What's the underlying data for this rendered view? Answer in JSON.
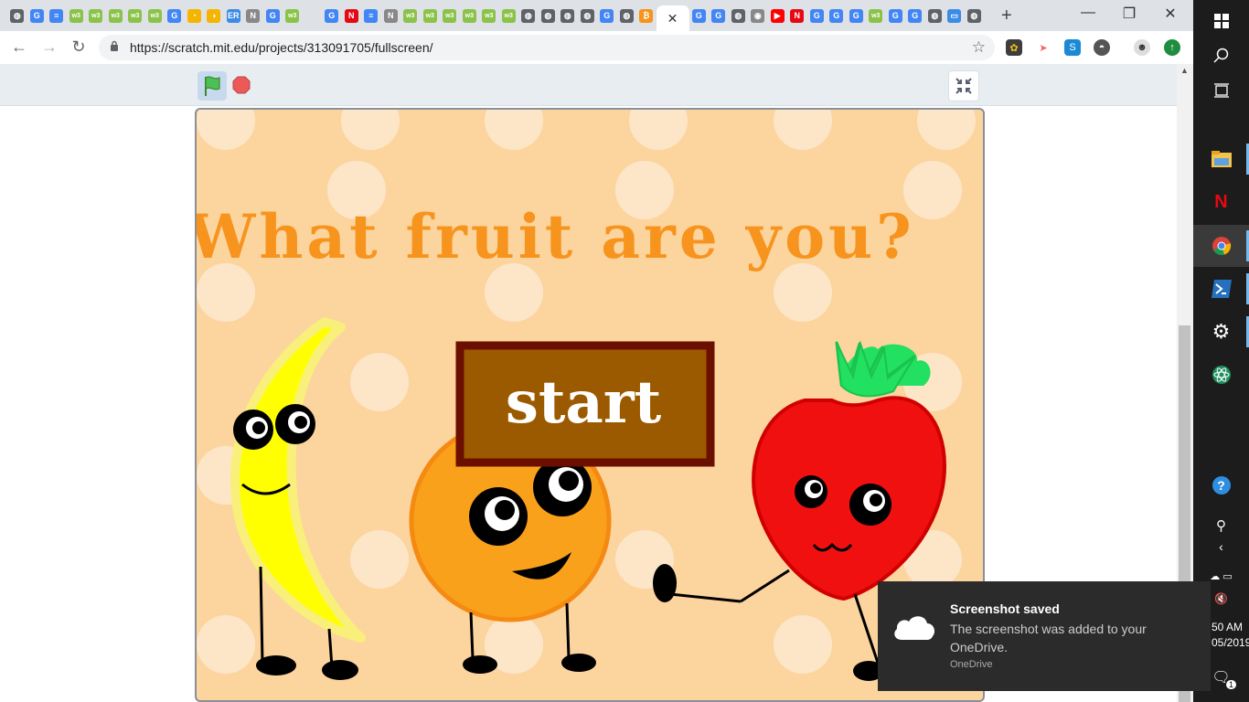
{
  "browser": {
    "tabs": [
      {
        "icon": "globe",
        "color": "#5f6368",
        "glyph": "◍"
      },
      {
        "icon": "google",
        "color": "#4285f4",
        "glyph": "G"
      },
      {
        "icon": "docs",
        "color": "#4285f4",
        "glyph": "≡"
      },
      {
        "icon": "w3",
        "color": "#8bc34a",
        "glyph": "w3"
      },
      {
        "icon": "w3",
        "color": "#8bc34a",
        "glyph": "w3"
      },
      {
        "icon": "w3",
        "color": "#8bc34a",
        "glyph": "w3"
      },
      {
        "icon": "w3",
        "color": "#8bc34a",
        "glyph": "w3"
      },
      {
        "icon": "w3",
        "color": "#8bc34a",
        "glyph": "w3"
      },
      {
        "icon": "google",
        "color": "#4285f4",
        "glyph": "G"
      },
      {
        "icon": "rainbow",
        "color": "#f4b400",
        "glyph": "◔"
      },
      {
        "icon": "khan",
        "color": "#f4b400",
        "glyph": "◑"
      },
      {
        "icon": "reader",
        "color": "#3c8be6",
        "glyph": "ER"
      },
      {
        "icon": "notion",
        "color": "#888",
        "glyph": "N"
      },
      {
        "icon": "google",
        "color": "#4285f4",
        "glyph": "G"
      },
      {
        "icon": "w3",
        "color": "#8bc34a",
        "glyph": "w3"
      },
      {
        "icon": "blank",
        "color": "#dee1e6",
        "glyph": ""
      },
      {
        "icon": "google",
        "color": "#4285f4",
        "glyph": "G"
      },
      {
        "icon": "netflix",
        "color": "#e50914",
        "glyph": "N"
      },
      {
        "icon": "docs",
        "color": "#4285f4",
        "glyph": "≡"
      },
      {
        "icon": "notion",
        "color": "#888",
        "glyph": "N"
      },
      {
        "icon": "w3",
        "color": "#8bc34a",
        "glyph": "w3"
      },
      {
        "icon": "w3",
        "color": "#8bc34a",
        "glyph": "w3"
      },
      {
        "icon": "w3",
        "color": "#8bc34a",
        "glyph": "w3"
      },
      {
        "icon": "w3",
        "color": "#8bc34a",
        "glyph": "w3"
      },
      {
        "icon": "w3",
        "color": "#8bc34a",
        "glyph": "w3"
      },
      {
        "icon": "w3",
        "color": "#8bc34a",
        "glyph": "w3"
      },
      {
        "icon": "globe",
        "color": "#5f6368",
        "glyph": "◍"
      },
      {
        "icon": "globe",
        "color": "#5f6368",
        "glyph": "◍"
      },
      {
        "icon": "globe",
        "color": "#5f6368",
        "glyph": "◍"
      },
      {
        "icon": "globe",
        "color": "#5f6368",
        "glyph": "◍"
      },
      {
        "icon": "google",
        "color": "#4285f4",
        "glyph": "G"
      },
      {
        "icon": "globe",
        "color": "#5f6368",
        "glyph": "◍"
      },
      {
        "icon": "bitcoin",
        "color": "#f7931a",
        "glyph": "₿"
      },
      {
        "icon": "close",
        "color": "#fff",
        "glyph": "✕",
        "active": true
      },
      {
        "icon": "google",
        "color": "#4285f4",
        "glyph": "G"
      },
      {
        "icon": "google",
        "color": "#4285f4",
        "glyph": "G"
      },
      {
        "icon": "globe",
        "color": "#5f6368",
        "glyph": "◍"
      },
      {
        "icon": "owl",
        "color": "#888",
        "glyph": "◉"
      },
      {
        "icon": "youtube",
        "color": "#ff0000",
        "glyph": "▶"
      },
      {
        "icon": "netflix",
        "color": "#e50914",
        "glyph": "N"
      },
      {
        "icon": "google",
        "color": "#4285f4",
        "glyph": "G"
      },
      {
        "icon": "google",
        "color": "#4285f4",
        "glyph": "G"
      },
      {
        "icon": "google",
        "color": "#4285f4",
        "glyph": "G"
      },
      {
        "icon": "w3",
        "color": "#8bc34a",
        "glyph": "w3"
      },
      {
        "icon": "google",
        "color": "#4285f4",
        "glyph": "G"
      },
      {
        "icon": "google",
        "color": "#4285f4",
        "glyph": "G"
      },
      {
        "icon": "globe",
        "color": "#5f6368",
        "glyph": "◍"
      },
      {
        "icon": "screen",
        "color": "#3c8be6",
        "glyph": "▭"
      },
      {
        "icon": "globe",
        "color": "#5f6368",
        "glyph": "◍"
      }
    ],
    "new_tab": "+",
    "minimize": "—",
    "restore": "❐",
    "close": "✕",
    "back": "←",
    "forward": "→",
    "reload": "↻",
    "url": "https://scratch.mit.edu/projects/313091705/fullscreen/",
    "lock": "🔒",
    "star": "☆"
  },
  "scratch": {
    "title": "What fruit are you?",
    "start_label": "start",
    "colors": {
      "background": "#fcd49e",
      "dots": "#fde6c8",
      "title": "#f7941d",
      "button_fill": "#9c5a00",
      "button_border": "#6b0f00",
      "banana": "#ffff00",
      "orange": "#f9a11b",
      "strawberry": "#f01010",
      "leaves": "#22e060"
    }
  },
  "toast": {
    "title": "Screenshot saved",
    "body": "The screenshot was added to your OneDrive.",
    "source": "OneDrive"
  },
  "taskbar": {
    "time": "50 AM",
    "date": "05/2019",
    "notification_count": "1"
  }
}
